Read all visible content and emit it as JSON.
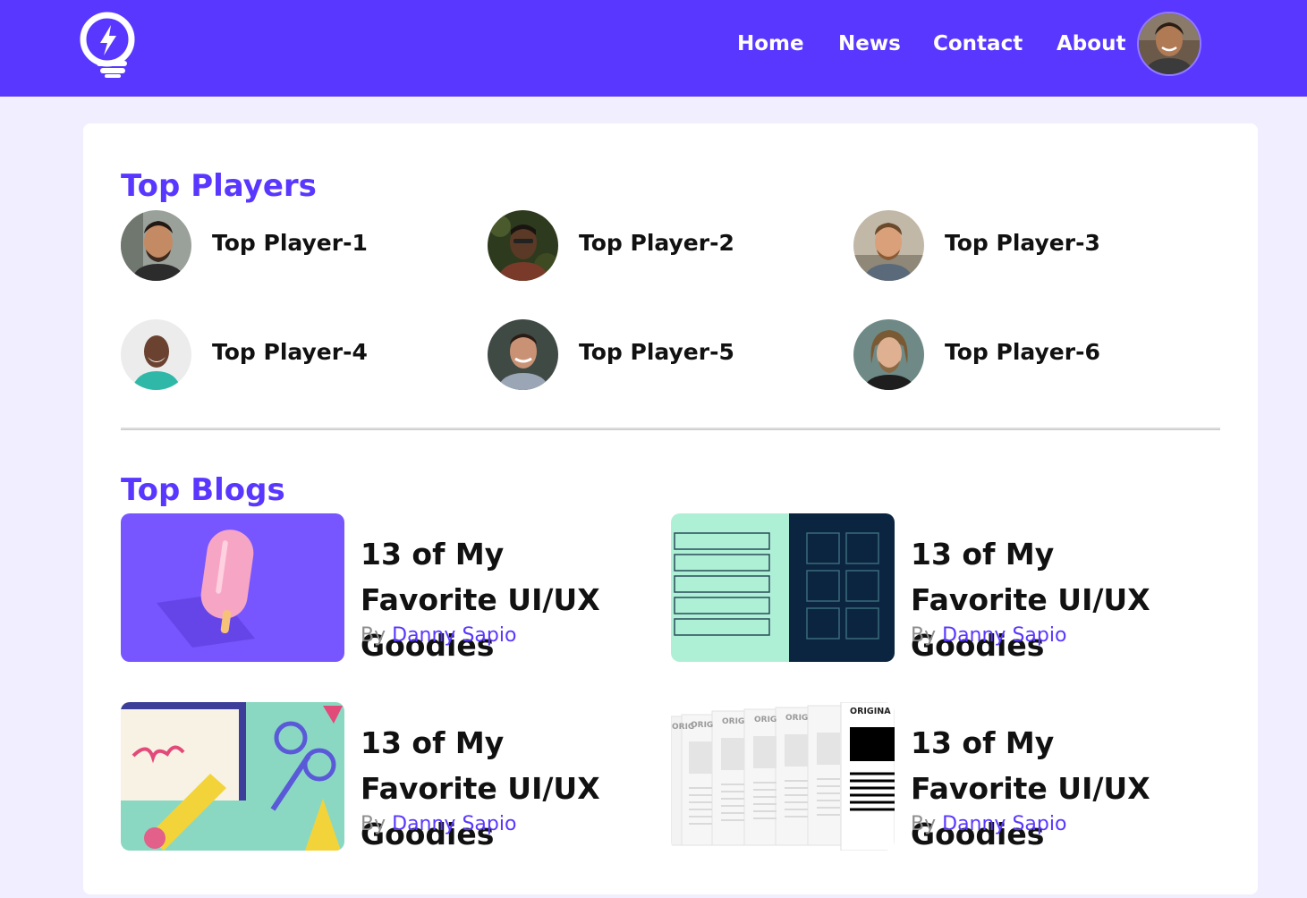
{
  "colors": {
    "brand": "#5a37ff",
    "background": "#f1efff",
    "card": "#ffffff",
    "text": "#111111",
    "muted": "#8d8d8d"
  },
  "nav": {
    "logo_icon": "lightbulb-bolt-icon",
    "links": [
      "Home",
      "News",
      "Contact",
      "About"
    ],
    "avatar": "user-avatar"
  },
  "players": {
    "title": "Top Players",
    "items": [
      {
        "name": "Top Player-1"
      },
      {
        "name": "Top Player-2"
      },
      {
        "name": "Top Player-3"
      },
      {
        "name": "Top Player-4"
      },
      {
        "name": "Top Player-5"
      },
      {
        "name": "Top Player-6"
      }
    ]
  },
  "blogs": {
    "title": "Top Blogs",
    "by": "By",
    "items": [
      {
        "title": "13 of My Favorite UI/UX Goodies",
        "author": "Danny Sapio"
      },
      {
        "title": "13 of My Favorite UI/UX Goodies",
        "author": "Danny Sapio"
      },
      {
        "title": "13 of My Favorite UI/UX Goodies",
        "author": "Danny Sapio"
      },
      {
        "title": "13 of My Favorite UI/UX Goodies",
        "author": "Danny Sapio"
      }
    ],
    "thumb_texts": [
      "ORIG",
      "ORIG",
      "ORIG",
      "ORIG",
      "ORIG",
      "ORIGINA"
    ]
  }
}
